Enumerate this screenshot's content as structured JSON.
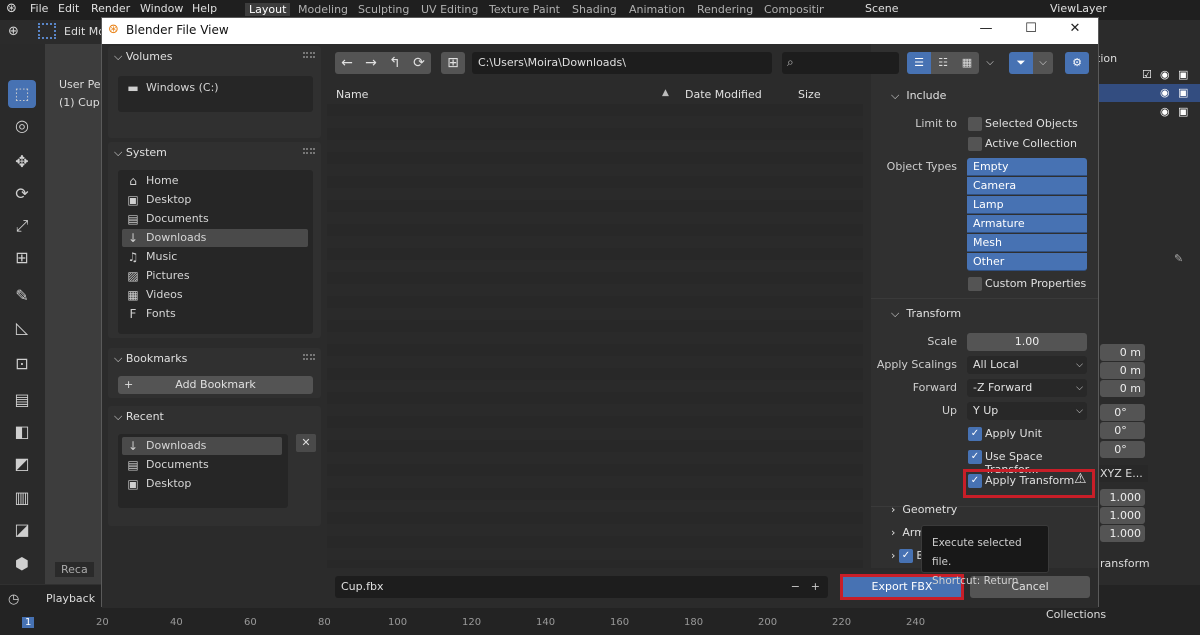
{
  "app_menu": [
    "File",
    "Edit",
    "Render",
    "Window",
    "Help"
  ],
  "workspace_tabs": [
    "Layout",
    "Modeling",
    "Sculpting",
    "UV Editing",
    "Texture Paint",
    "Shading",
    "Animation",
    "Rendering",
    "Compositing"
  ],
  "scene": "Scene",
  "view_layer": "ViewLayer",
  "edit_mode": "Edit Mo",
  "viewport_info": [
    "User Per",
    "(1) Cup"
  ],
  "recall_label": "Reca",
  "playback_label": "Playback",
  "timeline_ticks": [
    "1",
    "20",
    "40",
    "60",
    "80",
    "100",
    "120",
    "140",
    "160",
    "180",
    "200",
    "220",
    "240"
  ],
  "right_panel": {
    "label_ion": "tion",
    "values_m": [
      "0 m",
      "0 m",
      "0 m"
    ],
    "values_deg": [
      "0°",
      "0°",
      "0°"
    ],
    "rot_mode": "XYZ E...",
    "scales": [
      "1.000",
      "1.000",
      "1.000"
    ],
    "transform_label": "ransform",
    "collections": "Collections"
  },
  "dialog": {
    "title": "Blender File View",
    "window_buttons": {
      "minimize": "—",
      "maximize": "☐",
      "close": "✕"
    },
    "sidebar": {
      "volumes_header": "Volumes",
      "volumes": [
        "Windows (C:)"
      ],
      "system_header": "System",
      "system_items": [
        {
          "label": "Home",
          "icon": "home-icon",
          "glyph": "⌂"
        },
        {
          "label": "Desktop",
          "icon": "desktop-icon",
          "glyph": "▣"
        },
        {
          "label": "Documents",
          "icon": "documents-icon",
          "glyph": "▤"
        },
        {
          "label": "Downloads",
          "icon": "downloads-icon",
          "glyph": "↓"
        },
        {
          "label": "Music",
          "icon": "music-icon",
          "glyph": "♫"
        },
        {
          "label": "Pictures",
          "icon": "pictures-icon",
          "glyph": "▨"
        },
        {
          "label": "Videos",
          "icon": "videos-icon",
          "glyph": "▦"
        },
        {
          "label": "Fonts",
          "icon": "fonts-icon",
          "glyph": "F"
        }
      ],
      "bookmarks_header": "Bookmarks",
      "add_bookmark": "Add Bookmark",
      "recent_header": "Recent",
      "recent_items": [
        {
          "label": "Downloads",
          "icon": "downloads-icon",
          "glyph": "↓"
        },
        {
          "label": "Documents",
          "icon": "documents-icon",
          "glyph": "▤"
        },
        {
          "label": "Desktop",
          "icon": "desktop-icon",
          "glyph": "▣"
        }
      ]
    },
    "path": "C:\\Users\\Moira\\Downloads\\",
    "columns": {
      "name": "Name",
      "date": "Date Modified",
      "size": "Size"
    },
    "filename": "Cup.fbx",
    "export_button": "Export FBX",
    "cancel_button": "Cancel",
    "tooltip": {
      "line1": "Execute selected file.",
      "line2": "Shortcut: Return"
    },
    "settings": {
      "include_header": "Include",
      "limit_to_label": "Limit to",
      "selected_objects": "Selected Objects",
      "active_collection": "Active Collection",
      "object_types_label": "Object Types",
      "object_types": [
        "Empty",
        "Camera",
        "Lamp",
        "Armature",
        "Mesh",
        "Other"
      ],
      "custom_properties": "Custom Properties",
      "transform_header": "Transform",
      "scale_label": "Scale",
      "scale_value": "1.00",
      "apply_scalings_label": "Apply Scalings",
      "apply_scalings_value": "All Local",
      "forward_label": "Forward",
      "forward_value": "-Z Forward",
      "up_label": "Up",
      "up_value": "Y Up",
      "apply_unit": "Apply Unit",
      "use_space_transform": "Use Space Transfor...",
      "apply_transform": "Apply Transform",
      "geometry_header": "Geometry",
      "armature_header": "Arm",
      "bake_header": "B"
    }
  },
  "colors": {
    "accent": "#4772b3",
    "highlight": "#c81e28"
  }
}
